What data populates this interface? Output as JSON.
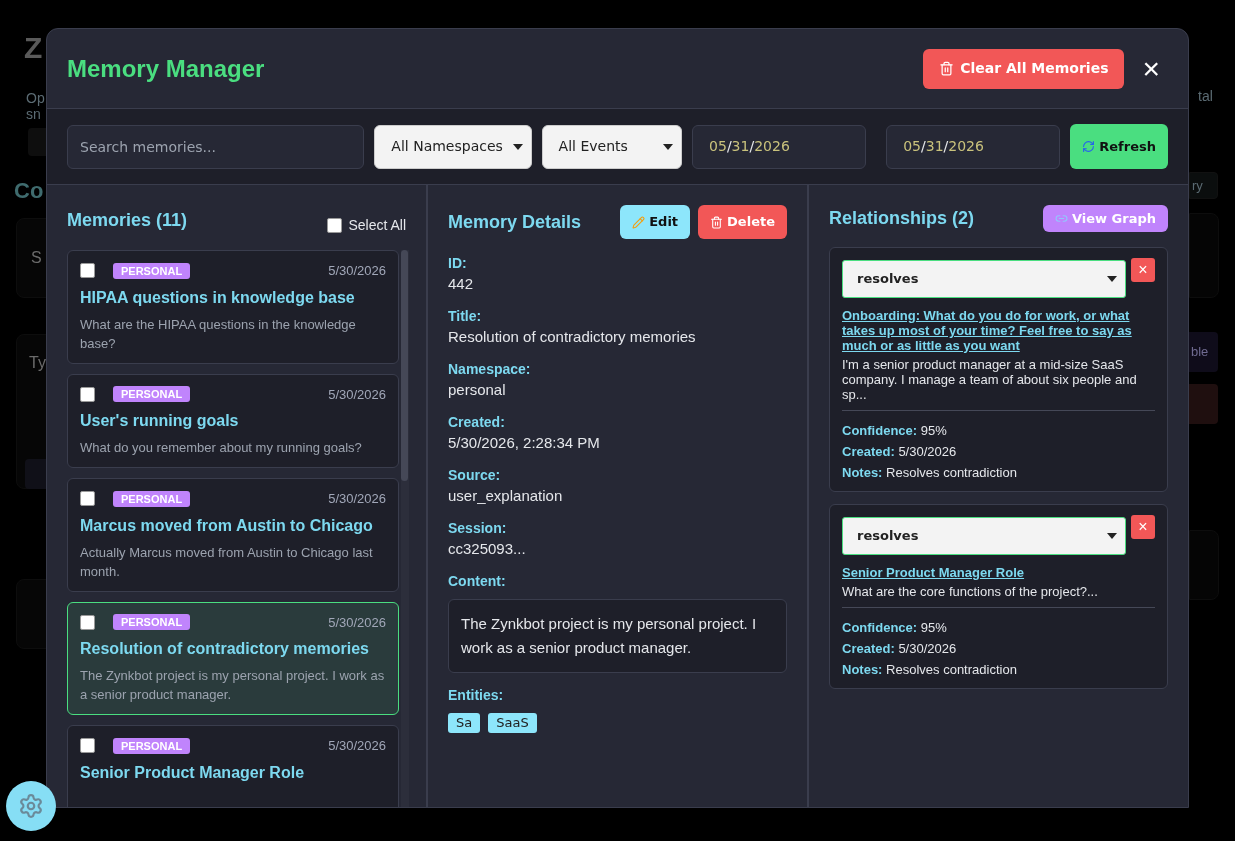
{
  "background_page": {
    "left_fragments": {
      "heading": "Z",
      "line_1": "Op",
      "line_2": "sn",
      "section_title": "Co",
      "card_text": "S",
      "textarea_text": "Ty"
    },
    "right_fragments": {
      "line_1": "tal",
      "button_1": "ry",
      "button_2": "ble"
    }
  },
  "modal": {
    "title": "Memory Manager",
    "clear_button": "Clear All Memories",
    "close_button": "×"
  },
  "toolbar": {
    "search": {
      "placeholder": "Search memories..."
    },
    "namespace_select": "All Namespaces",
    "event_select": "All Events",
    "date_from": "05/31/2026",
    "date_to": "05/31/2026",
    "refresh_button": "Refresh"
  },
  "memories": {
    "title": "Memories (11)",
    "select_all": {
      "label": "Select All",
      "checked": false
    },
    "items": [
      {
        "tag": "PERSONAL",
        "date": "5/30/2026",
        "title": "HIPAA questions in knowledge base",
        "summary": "What are the HIPAA questions in the knowledge base?",
        "checked": false,
        "selected": false
      },
      {
        "tag": "PERSONAL",
        "date": "5/30/2026",
        "title": "User's running goals",
        "summary": "What do you remember about my running goals?",
        "checked": false,
        "selected": false
      },
      {
        "tag": "PERSONAL",
        "date": "5/30/2026",
        "title": "Marcus moved from Austin to Chicago",
        "summary": "Actually Marcus moved from Austin to Chicago last month.",
        "checked": false,
        "selected": false
      },
      {
        "tag": "PERSONAL",
        "date": "5/30/2026",
        "title": "Resolution of contradictory memories",
        "summary": "The Zynkbot project is my personal project. I work as a senior product manager.",
        "checked": false,
        "selected": true
      },
      {
        "tag": "PERSONAL",
        "date": "5/30/2026",
        "title": "Senior Product Manager Role",
        "checked": false,
        "selected": false
      }
    ]
  },
  "details": {
    "title": "Memory Details",
    "edit_button": "Edit",
    "delete_button": "Delete",
    "fields": [
      {
        "label": "ID:",
        "value": "442"
      },
      {
        "label": "Title:",
        "value": "Resolution of contradictory memories"
      },
      {
        "label": "Namespace:",
        "value": "personal"
      },
      {
        "label": "Created:",
        "value": "5/30/2026, 2:28:34 PM"
      },
      {
        "label": "Source:",
        "value": "user_explanation"
      },
      {
        "label": "Session:",
        "value": "cc325093..."
      }
    ],
    "content_label": "Content:",
    "content": "The Zynkbot project is my personal project. I work as a senior product manager.",
    "entities_label": "Entities:",
    "entities": [
      "Sa",
      "SaaS"
    ]
  },
  "relationships": {
    "title": "Relationships (2)",
    "view_graph_button": "View Graph",
    "items": [
      {
        "type": "resolves",
        "link": "Onboarding: What do you do for work, or what takes up most of your time? Feel free to say as much or as little as you want",
        "excerpt": "I'm a senior product manager at a mid-size SaaS company. I manage a team of about six people and sp...",
        "remove": "×",
        "meta": [
          {
            "label": "Confidence:",
            "value": "95%"
          },
          {
            "label": "Created:",
            "value": "5/30/2026"
          },
          {
            "label": "Notes:",
            "value": "Resolves contradiction"
          }
        ]
      },
      {
        "type": "resolves",
        "link": "Senior Product Manager Role",
        "excerpt": "What are the core functions of the project?...",
        "remove": "×",
        "meta": [
          {
            "label": "Confidence:",
            "value": "95%"
          },
          {
            "label": "Created:",
            "value": "5/30/2026"
          },
          {
            "label": "Notes:",
            "value": "Resolves contradiction"
          }
        ]
      }
    ]
  }
}
